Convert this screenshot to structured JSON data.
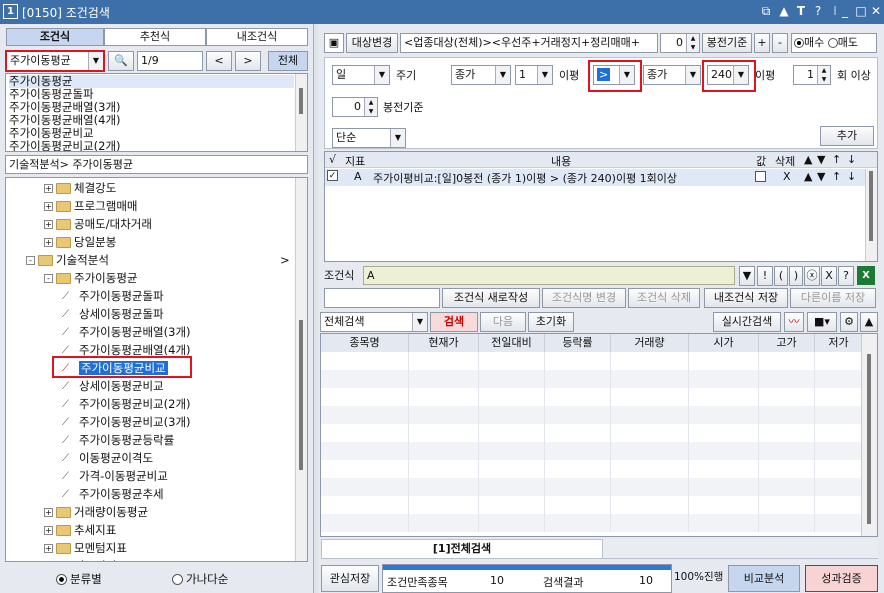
{
  "window": {
    "num": "1",
    "title": "[0150] 조건검색"
  },
  "left": {
    "tabs": [
      "조건식",
      "추천식",
      "내조건식"
    ],
    "search_value": "주가이동평균",
    "page": "1/9",
    "prev": "<",
    "next": ">",
    "all": "전체",
    "results": [
      "주가이동평균",
      "주가이동평균돌파",
      "주가이동평균배열(3개)",
      "주가이동평균배열(4개)",
      "주가이동평균비교",
      "주가이동평균비교(2개)"
    ],
    "path": "기술적분석> 주가이동평균",
    "tree": [
      {
        "type": "folder",
        "pm": "+",
        "label": "체결강도",
        "indent": 1
      },
      {
        "type": "folder",
        "pm": "+",
        "label": "프로그램매매",
        "indent": 1
      },
      {
        "type": "folder",
        "pm": "+",
        "label": "공매도/대차거래",
        "indent": 1
      },
      {
        "type": "folder",
        "pm": "+",
        "label": "당일분봉",
        "indent": 1
      },
      {
        "type": "folder",
        "pm": "-",
        "label": "기술적분석",
        "indent": 0,
        "tail": ">"
      },
      {
        "type": "folder",
        "pm": "-",
        "label": "주가이동평균",
        "indent": 1
      },
      {
        "type": "item",
        "label": "주가이동평균돌파",
        "indent": 2
      },
      {
        "type": "item",
        "label": "상세이동평균돌파",
        "indent": 2
      },
      {
        "type": "item",
        "label": "주가이동평균배열(3개)",
        "indent": 2
      },
      {
        "type": "item",
        "label": "주가이동평균배열(4개)",
        "indent": 2
      },
      {
        "type": "item",
        "label": "주가이동평균비교",
        "indent": 2,
        "selected": true
      },
      {
        "type": "item",
        "label": "상세이동평균비교",
        "indent": 2
      },
      {
        "type": "item",
        "label": "주가이동평균비교(2개)",
        "indent": 2
      },
      {
        "type": "item",
        "label": "주가이동평균비교(3개)",
        "indent": 2
      },
      {
        "type": "item",
        "label": "주가이동평균등락률",
        "indent": 2
      },
      {
        "type": "item",
        "label": "이동평균이격도",
        "indent": 2
      },
      {
        "type": "item",
        "label": "가격-이동평균비교",
        "indent": 2
      },
      {
        "type": "item",
        "label": "주가이동평균추세",
        "indent": 2
      },
      {
        "type": "folder",
        "pm": "+",
        "label": "거래량이동평균",
        "indent": 1
      },
      {
        "type": "folder",
        "pm": "+",
        "label": "추세지표",
        "indent": 1
      },
      {
        "type": "folder",
        "pm": "+",
        "label": "모멘텀지표",
        "indent": 1
      },
      {
        "type": "folder",
        "pm": "+",
        "label": "변동성지표",
        "indent": 1
      }
    ],
    "radio_category": "분류별",
    "radio_alpha": "가나다순"
  },
  "top": {
    "target_btn": "대상변경",
    "target_text": "<업종대상(전체)><우선주+거래정지+정리매매+",
    "bongjeon_value": "0",
    "bongjeon_label": "봉전기준",
    "plus": "+",
    "minus": "-",
    "buy": "매수",
    "sell": "매도"
  },
  "params": {
    "period": "일",
    "period_label": "주기",
    "price1": "종가",
    "ma1": "1",
    "ma_label1": "이평",
    "op": ">",
    "price2": "종가",
    "ma2": "240",
    "ma_label2": "이평",
    "times": "1",
    "times_label": "회 이상",
    "bong_value": "0",
    "bong_label": "봉전기준",
    "mode": "단순",
    "add": "추가"
  },
  "cond_table": {
    "headers": [
      "√",
      "지표",
      "내용",
      "값",
      "삭제",
      "▲",
      "▼",
      "↑",
      "↓"
    ],
    "rows": [
      {
        "check": "✓",
        "id": "A",
        "content": "주가이평비교:[일]0봉전 (종가 1)이평 > (종가 240)이평 1회이상",
        "del": "X"
      }
    ]
  },
  "condexpr": {
    "label": "조건식",
    "value": "A",
    "symbols": [
      "▼",
      "!",
      "(",
      ")",
      "ⓧ",
      "X",
      "?"
    ]
  },
  "actions": [
    "조건식 새로작성",
    "조건식명 변경",
    "조건식 삭제",
    "내조건식 저장",
    "다른이름 저장"
  ],
  "search_bar": {
    "scope": "전체검색",
    "search": "검색",
    "next": "다음",
    "reset": "초기화",
    "realtime": "실시간검색"
  },
  "result_headers": [
    "종목명",
    "현재가",
    "전일대비",
    "등락률",
    "거래량",
    "시가",
    "고가",
    "저가"
  ],
  "bottom_tab": "[1]전체검색",
  "status": {
    "save": "관심저장",
    "match_label": "조건만족종목",
    "match_value": "10",
    "result_label": "검색결과",
    "result_value": "10",
    "progress": "100%진행",
    "progress_fraction": 1.0,
    "compare": "비교분석",
    "verify": "성과검증"
  }
}
